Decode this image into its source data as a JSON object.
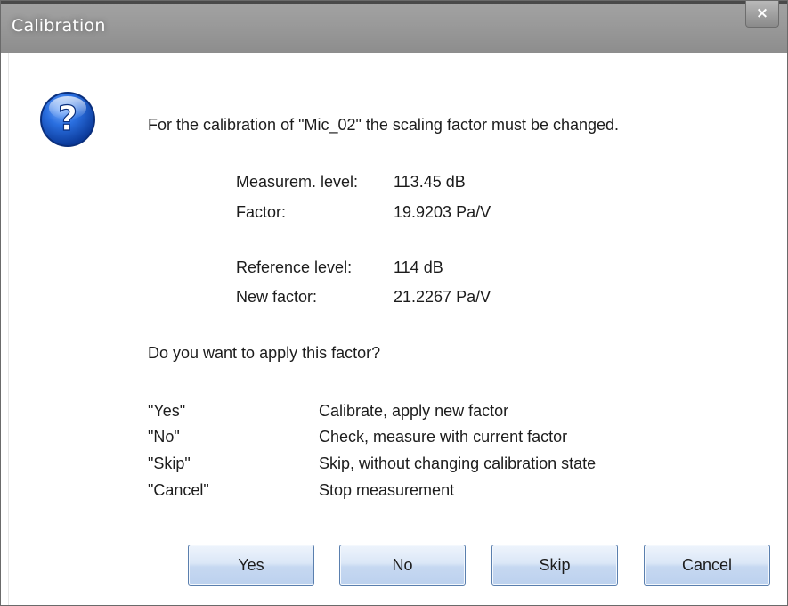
{
  "window": {
    "title": "Calibration",
    "close_glyph": "×"
  },
  "message": {
    "intro": "For the calibration of \"Mic_02\" the scaling factor must be changed.",
    "measurement_label": "Measurem. level:",
    "measurement_value": "113.45 dB",
    "factor_label": "Factor:",
    "factor_value": "19.9203 Pa/V",
    "reference_label": "Reference level:",
    "reference_value": "114 dB",
    "new_factor_label": "New factor:",
    "new_factor_value": "21.2267 Pa/V",
    "question": "Do you want to apply this factor?",
    "options": [
      {
        "key": "\"Yes\"",
        "desc": "Calibrate, apply new factor"
      },
      {
        "key": "\"No\"",
        "desc": "Check, measure with current factor"
      },
      {
        "key": "\"Skip\"",
        "desc": "Skip, without changing calibration state"
      },
      {
        "key": "\"Cancel\"",
        "desc": "Stop measurement"
      }
    ]
  },
  "buttons": {
    "yes": "Yes",
    "no": "No",
    "skip": "Skip",
    "cancel": "Cancel"
  },
  "icon": {
    "name": "question-icon",
    "glyph": "?",
    "color": "#1d5fcf"
  },
  "colors": {
    "titlebar": "#9a9a9a",
    "button_border": "#5a7fae",
    "button_fill": "#c6d8f1"
  }
}
